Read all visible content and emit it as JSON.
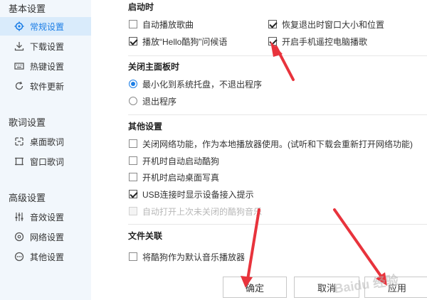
{
  "sidebar": {
    "sections": [
      {
        "title": "基本设置",
        "items": [
          {
            "label": "常规设置",
            "icon": "gear-icon",
            "active": true
          },
          {
            "label": "下载设置",
            "icon": "download-icon"
          },
          {
            "label": "热键设置",
            "icon": "keyboard-icon"
          },
          {
            "label": "软件更新",
            "icon": "refresh-icon"
          }
        ]
      },
      {
        "title": "歌词设置",
        "items": [
          {
            "label": "桌面歌词",
            "icon": "desktop-lyrics-icon"
          },
          {
            "label": "窗口歌词",
            "icon": "window-lyrics-icon"
          }
        ]
      },
      {
        "title": "高级设置",
        "items": [
          {
            "label": "音效设置",
            "icon": "equalizer-icon"
          },
          {
            "label": "网络设置",
            "icon": "network-icon"
          },
          {
            "label": "其他设置",
            "icon": "more-icon"
          }
        ]
      }
    ]
  },
  "startup": {
    "title": "启动时",
    "opt1": {
      "label": "自动播放歌曲",
      "checked": false
    },
    "opt2": {
      "label": "恢复退出时窗口大小和位置",
      "checked": true
    },
    "opt3": {
      "label": "播放“Hello酷狗”问候语",
      "checked": true
    },
    "opt4": {
      "label": "开启手机遥控电脑播歌",
      "checked": true
    }
  },
  "close_panel": {
    "title": "关闭主面板时",
    "opt1": {
      "label": "最小化到系统托盘，不退出程序",
      "checked": true
    },
    "opt2": {
      "label": "退出程序",
      "checked": false
    }
  },
  "other": {
    "title": "其他设置",
    "opt1": {
      "label": "关闭网络功能，作为本地播放器使用。(试听和下载会重新打开网络功能)",
      "checked": false
    },
    "opt2": {
      "label": "开机时自动启动酷狗",
      "checked": false
    },
    "opt3": {
      "label": "开机时启动桌面写真",
      "checked": false
    },
    "opt4": {
      "label": "USB连接时显示设备接入提示",
      "checked": true
    },
    "opt5": {
      "label": "自动打开上次未关闭的酷狗音乐",
      "checked": false,
      "disabled": true
    }
  },
  "file_assoc": {
    "title": "文件关联",
    "opt1": {
      "label": "将酷狗作为默认音乐播放器",
      "checked": false
    }
  },
  "buttons": {
    "ok": "确定",
    "cancel": "取消",
    "apply": "应用"
  },
  "watermark": "Baidu 经验",
  "colors": {
    "accent": "#1c7ee6",
    "sidebar_bg": "#f2f7fc",
    "annotation": "#e8333c"
  }
}
